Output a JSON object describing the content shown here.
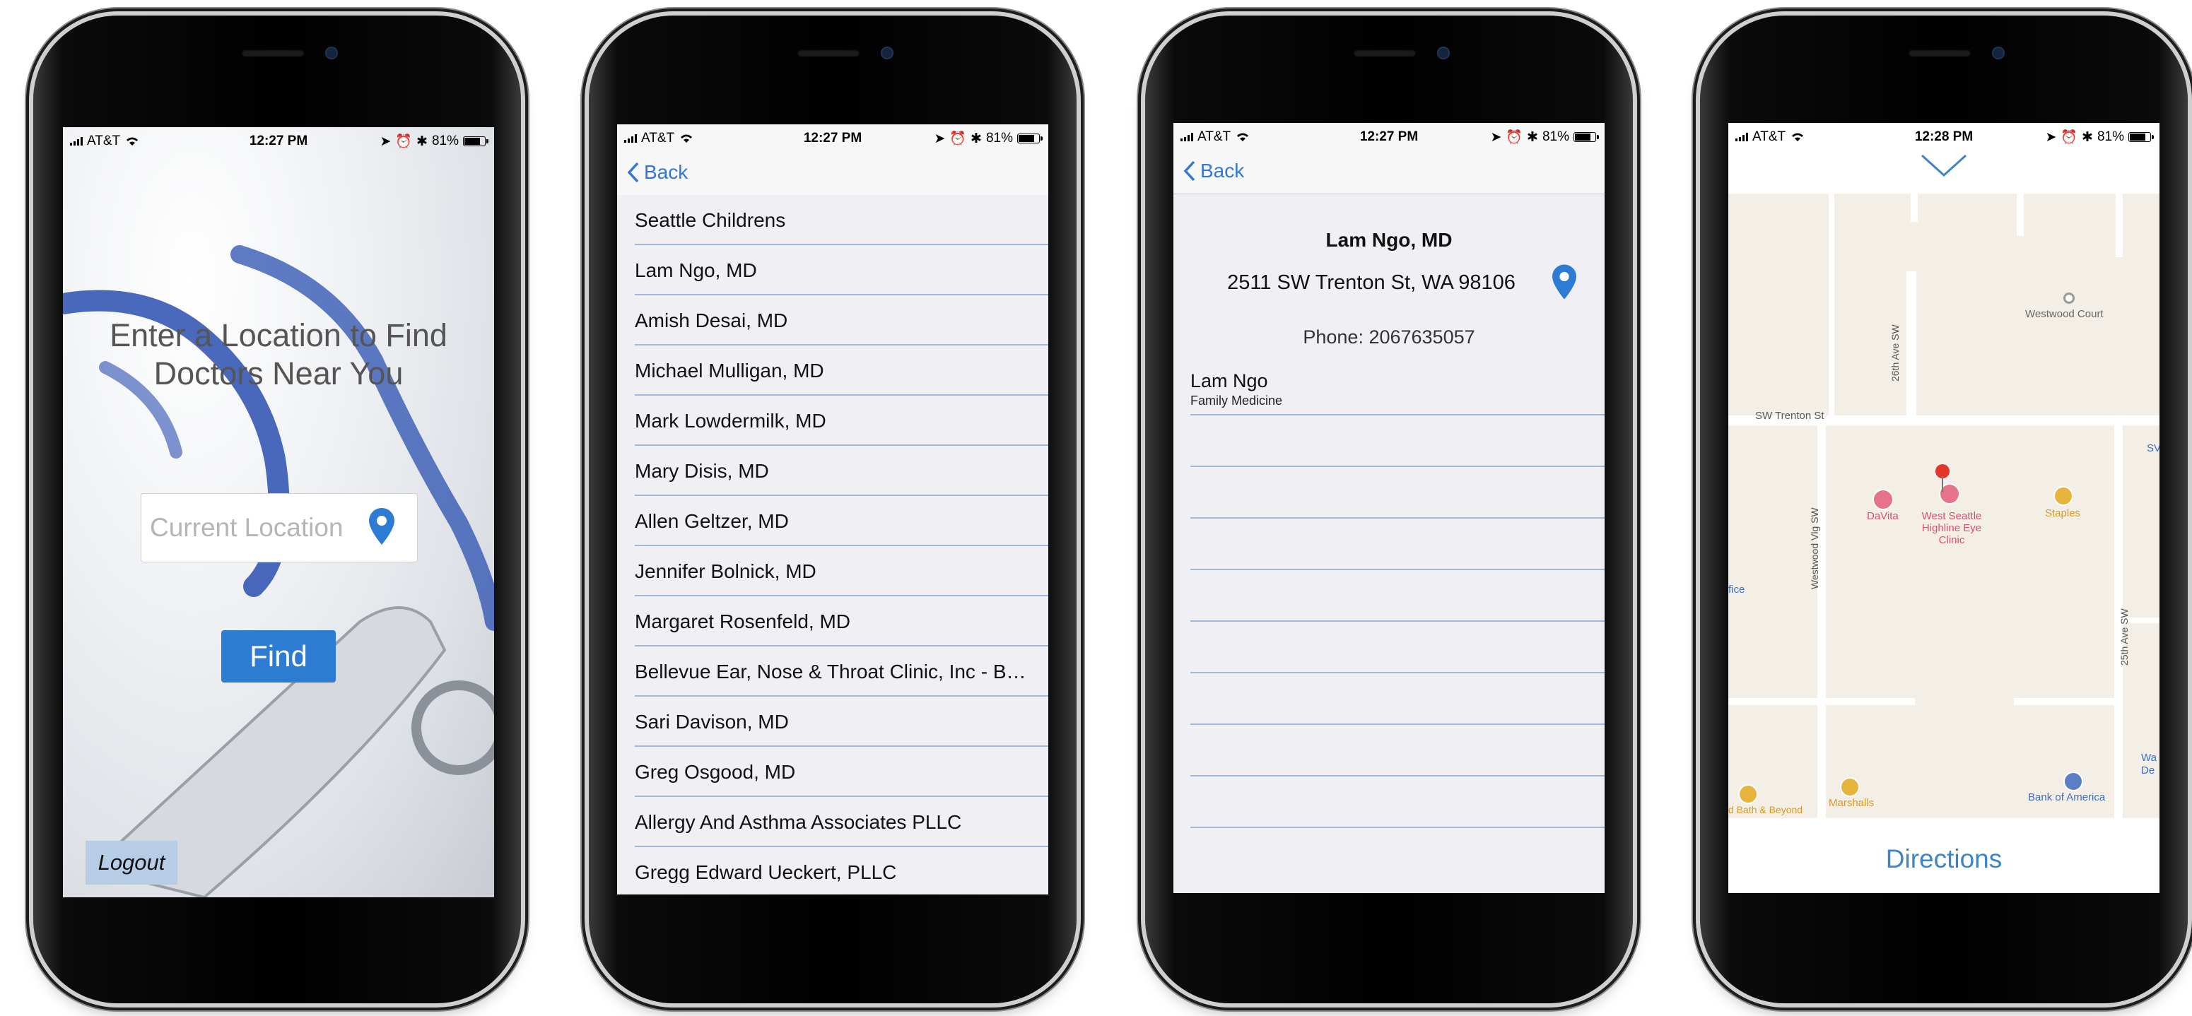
{
  "status": {
    "carrier": "AT&T",
    "battery": "81%",
    "battery_level": 0.81,
    "times": [
      "12:27 PM",
      "12:27 PM",
      "12:27 PM",
      "12:28 PM"
    ]
  },
  "screen1": {
    "title": "Enter a Location to Find Doctors Near You",
    "location_placeholder": "Current Location",
    "find_label": "Find",
    "logout_label": "Logout"
  },
  "screen2": {
    "back_label": "Back",
    "items": [
      "Seattle Childrens",
      "Lam Ngo, MD",
      "Amish Desai, MD",
      "Michael Mulligan, MD",
      "Mark Lowdermilk, MD",
      "Mary Disis, MD",
      "Allen Geltzer, MD",
      "Jennifer Bolnick, MD",
      "Margaret Rosenfeld, MD",
      "Bellevue Ear, Nose & Throat Clinic, Inc - Bel...",
      "Sari Davison, MD",
      "Greg Osgood, MD",
      "Allergy And Asthma Associates PLLC",
      "Gregg Edward Ueckert, PLLC"
    ]
  },
  "screen3": {
    "back_label": "Back",
    "name": "Lam Ngo, MD",
    "address": "2511 SW Trenton St, WA 98106",
    "phone": "Phone: 2067635057",
    "doctor_name": "Lam Ngo",
    "specialty": "Family Medicine"
  },
  "screen4": {
    "directions_label": "Directions",
    "map_labels": {
      "westwood_court": "Westwood Court",
      "ave26": "26th Ave SW",
      "trenton": "SW Trenton St",
      "davita": "DaVita",
      "clinic": "West Seattle Highline Eye Clinic",
      "staples": "Staples",
      "westwood_vlg": "Westwood Vlg SW",
      "ave25": "25th Ave SW",
      "marshalls": "Marshalls",
      "bank": "Bank of America",
      "bed": "d Bath & Beyond",
      "fice": "fice",
      "sv": "SV",
      "wa": "Wa",
      "de": "De"
    }
  }
}
